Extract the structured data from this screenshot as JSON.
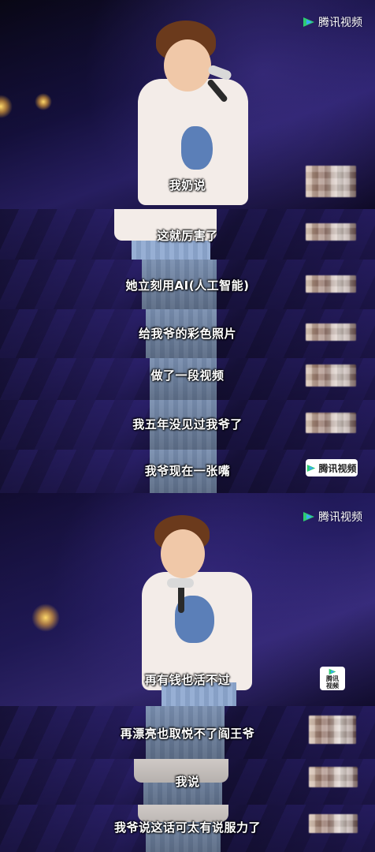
{
  "logo": {
    "text": "腾讯视频"
  },
  "captions": {
    "c1": "我奶说",
    "c2": "这就厉害了",
    "c3": "她立刻用AI(人工智能)",
    "c4": "给我爷的彩色照片",
    "c5": "做了一段视频",
    "c6": "我五年没见过我爷了",
    "c7": "我爷现在一张嘴",
    "c8": "再有钱也活不过",
    "c9": "再漂亮也取悦不了阎王爷",
    "c10": "我说",
    "c11": "我爷说这话可太有说服力了"
  },
  "badges": {
    "strip7": "腾讯视频",
    "strip8_line1": "腾讯",
    "strip8_line2": "视频"
  },
  "colors": {
    "logo_green": "#2ecc71",
    "logo_blue": "#3aa8ff",
    "caption_text": "#ffffff"
  }
}
